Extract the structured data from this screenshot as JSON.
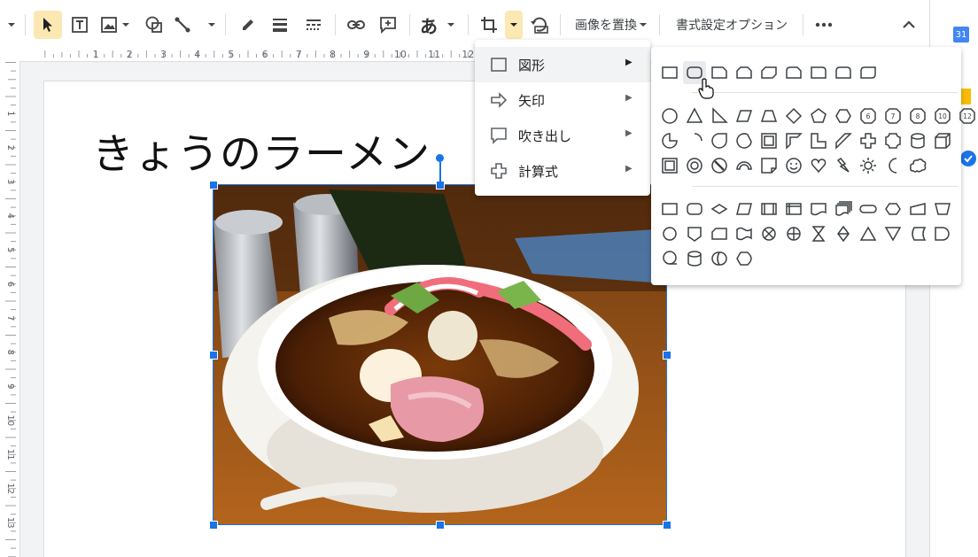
{
  "toolbar": {
    "icons": [
      "chevron-down-icon",
      "cursor-icon",
      "text-box-icon",
      "image-icon",
      "shape-icon",
      "line-icon",
      "pen-icon",
      "border-weight-icon",
      "border-dash-icon",
      "link-icon",
      "add-comment-icon",
      "input-tools-icon",
      "crop-icon",
      "mask-dropdown-icon",
      "reset-image-icon",
      "more-icon",
      "collapse-icon"
    ],
    "input_tool_label": "あ",
    "replace_image_label": "画像を置換",
    "format_options_label": "書式設定オプション"
  },
  "side_panel": {
    "calendar_label": "31"
  },
  "ruler": {
    "h_ticks": [
      "1",
      "2",
      "3",
      "4",
      "5",
      "6",
      "7",
      "8",
      "9",
      "10",
      "11",
      "12"
    ],
    "v_ticks": [
      "1",
      "2",
      "3",
      "4",
      "5",
      "6",
      "7",
      "8",
      "9",
      "10",
      "11",
      "12",
      "13"
    ]
  },
  "slide": {
    "title": "きょうのラーメン"
  },
  "mask_menu": {
    "items": [
      {
        "label": "図形",
        "icon": "rectangle-icon"
      },
      {
        "label": "矢印",
        "icon": "arrow-icon"
      },
      {
        "label": "吹き出し",
        "icon": "callout-icon"
      },
      {
        "label": "計算式",
        "icon": "plus-icon"
      }
    ],
    "arrow_glyph": "▶"
  },
  "shapes_submenu": {
    "row_labels": [
      "6",
      "7",
      "8",
      "10",
      "12"
    ],
    "hovered": "rounded-rectangle"
  },
  "colors": {
    "accent": "#1a73e8",
    "active_button": "#fce8b2"
  }
}
